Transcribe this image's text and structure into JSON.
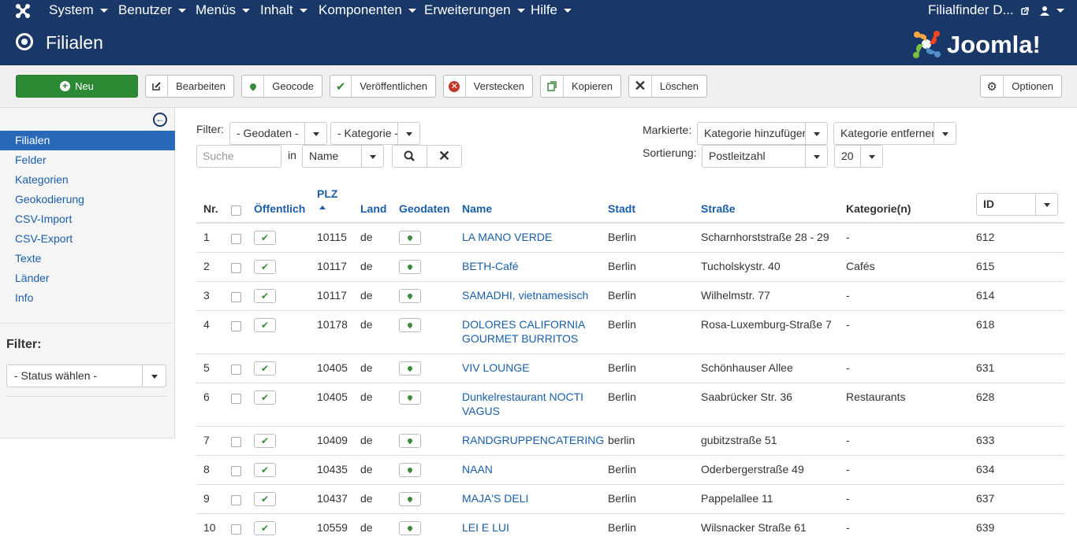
{
  "nav": {
    "items": [
      "System",
      "Benutzer",
      "Menüs",
      "Inhalt",
      "Komponenten",
      "Erweiterungen",
      "Hilfe"
    ],
    "site_link": "Filialfinder D...",
    "user_icon": "user-icon"
  },
  "header": {
    "title": "Filialen",
    "brand": "Joomla!"
  },
  "toolbar": {
    "new": "Neu",
    "edit": "Bearbeiten",
    "geocode": "Geocode",
    "publish": "Veröffentlichen",
    "hide": "Verstecken",
    "copy": "Kopieren",
    "delete": "Löschen",
    "options": "Optionen"
  },
  "sidebar": {
    "items": [
      "Filialen",
      "Felder",
      "Kategorien",
      "Geokodierung",
      "CSV-Import",
      "CSV-Export",
      "Texte",
      "Länder",
      "Info"
    ],
    "filter_title": "Filter:",
    "status_select": "- Status wählen -"
  },
  "filters": {
    "label": "Filter:",
    "geodaten": "- Geodaten -",
    "kategorie": "- Kategorie -",
    "search_placeholder": "Suche",
    "in_label": "in",
    "search_field": "Name",
    "markierte_label": "Markierte:",
    "sortierung_label": "Sortierung:",
    "cat_add": "Kategorie hinzufügen",
    "cat_remove": "Kategorie entfernen",
    "sort_by": "Postleitzahl",
    "limit": "20"
  },
  "table": {
    "headers": {
      "nr": "Nr.",
      "public": "Öffentlich",
      "plz": "PLZ",
      "land": "Land",
      "geodaten": "Geodaten",
      "name": "Name",
      "stadt": "Stadt",
      "strasse": "Straße",
      "kategorien": "Kategorie(n)",
      "id": "ID"
    },
    "rows": [
      {
        "nr": "1",
        "plz": "10115",
        "land": "de",
        "name": "LA MANO VERDE",
        "name2": "",
        "stadt": "Berlin",
        "strasse": "Scharnhorststraße 28 - 29",
        "kat": "-",
        "id": "612"
      },
      {
        "nr": "2",
        "plz": "10117",
        "land": "de",
        "name": "BETH-Café",
        "name2": "",
        "stadt": "Berlin",
        "strasse": "Tucholskystr. 40",
        "kat": "Cafés",
        "id": "615"
      },
      {
        "nr": "3",
        "plz": "10117",
        "land": "de",
        "name": "SAMADHI, vietnamesisch",
        "name2": "",
        "stadt": "Berlin",
        "strasse": "Wilhelmstr. 77",
        "kat": "-",
        "id": "614"
      },
      {
        "nr": "4",
        "plz": "10178",
        "land": "de",
        "name": "DOLORES CALIFORNIA",
        "name2": "GOURMET BURRITOS",
        "stadt": "Berlin",
        "strasse": "Rosa-Luxemburg-Straße 7",
        "kat": "-",
        "id": "618"
      },
      {
        "nr": "5",
        "plz": "10405",
        "land": "de",
        "name": "VIV LOUNGE",
        "name2": "",
        "stadt": "Berlin",
        "strasse": "Schönhauser Allee",
        "kat": "-",
        "id": "631"
      },
      {
        "nr": "6",
        "plz": "10405",
        "land": "de",
        "name": "Dunkelrestaurant NOCTI",
        "name2": "VAGUS",
        "stadt": "Berlin",
        "strasse": "Saabrücker Str. 36",
        "kat": "Restaurants",
        "id": "628"
      },
      {
        "nr": "7",
        "plz": "10409",
        "land": "de",
        "name": "RANDGRUPPENCATERING",
        "name2": "",
        "stadt": "berlin",
        "strasse": "gubitzstraße 51",
        "kat": "-",
        "id": "633"
      },
      {
        "nr": "8",
        "plz": "10435",
        "land": "de",
        "name": "NAAN",
        "name2": "",
        "stadt": "Berlin",
        "strasse": "Oderbergerstraße 49",
        "kat": "-",
        "id": "634"
      },
      {
        "nr": "9",
        "plz": "10437",
        "land": "de",
        "name": "MAJA'S DELI",
        "name2": "",
        "stadt": "Berlin",
        "strasse": "Pappelallee 11",
        "kat": "-",
        "id": "637"
      },
      {
        "nr": "10",
        "plz": "10559",
        "land": "de",
        "name": "LEI E LUI",
        "name2": "",
        "stadt": "Berlin",
        "strasse": "Wilsnacker Straße 61",
        "kat": "-",
        "id": "639"
      }
    ]
  },
  "colors": {
    "nav_bg": "#1a3867",
    "accent": "#2a69b8",
    "success": "#2d8a34",
    "link": "#1a5eaa"
  }
}
